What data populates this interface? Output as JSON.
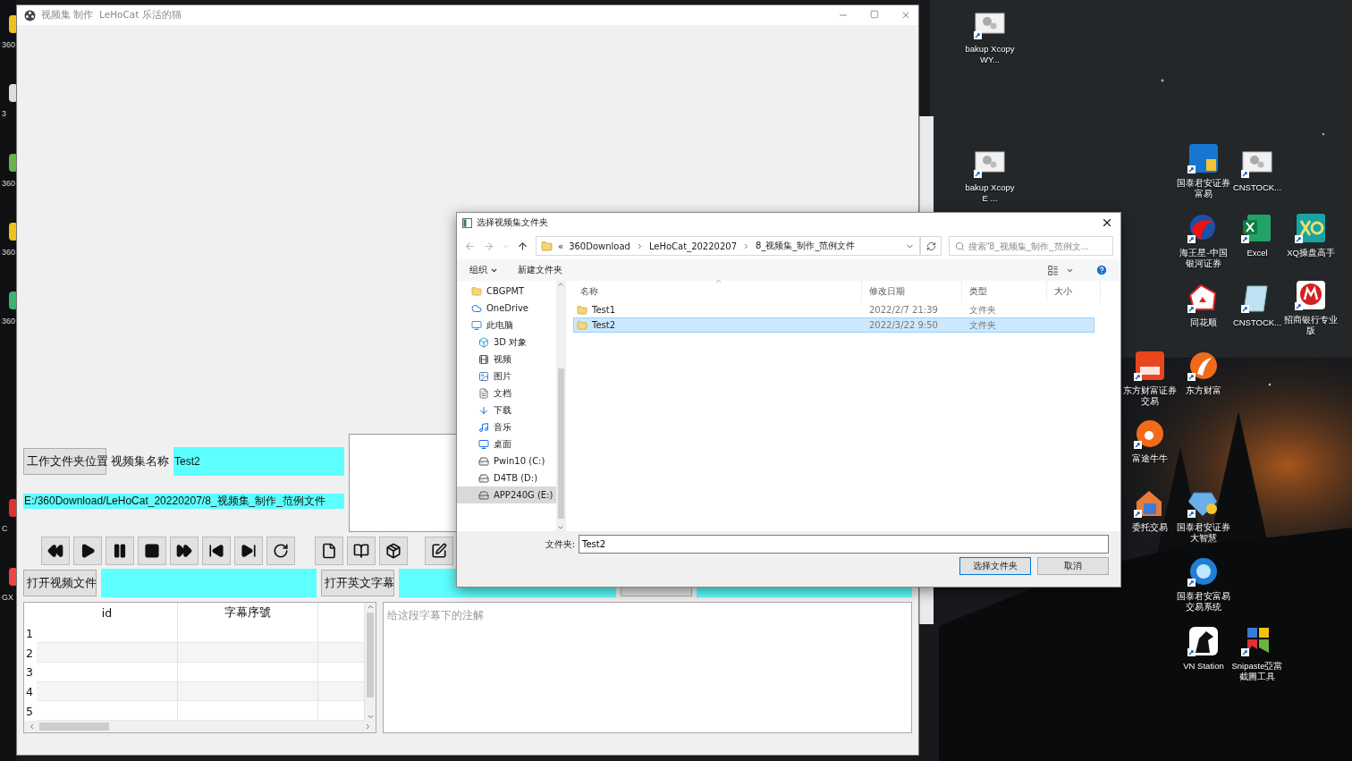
{
  "desktop_edge_labels": [
    "360",
    "3",
    "360",
    "360",
    "360",
    "C",
    "GX"
  ],
  "desktop_icons": [
    {
      "label": "bakup Xcopy WY..."
    },
    {
      "label": "bakup Xcopy E ..."
    },
    {
      "label": "国泰君安证券富易"
    },
    {
      "label": "CNSTOCK..."
    },
    {
      "label": "海王星-中国银河证券"
    },
    {
      "label": "Excel"
    },
    {
      "label": "XQ操盘高手"
    },
    {
      "label": "同花顺"
    },
    {
      "label": "CNSTOCK..."
    },
    {
      "label": "招商银行专业版"
    },
    {
      "label": "东方财富证券交易"
    },
    {
      "label": "东方财富"
    },
    {
      "label": "富途牛牛"
    },
    {
      "label": "委托交易"
    },
    {
      "label": "国泰君安证券大智慧"
    },
    {
      "label": "国泰君安富易交易系统"
    },
    {
      "label": "VN Station"
    },
    {
      "label": "Snipaste亞當截圖工具"
    }
  ],
  "main_window": {
    "title": "视频集 制作  LeHoCat 乐活的猫",
    "folder_button": "工作文件夹位置",
    "name_label": "视频集名称",
    "name_value": "Test2",
    "path_value": "E:/360Download/LeHoCat_20220207/8_视频集_制作_范例文件",
    "open_video_button": "打开视频文件",
    "open_subtitle_button": "打开英文字幕",
    "table": {
      "columns": [
        "id",
        "字幕序號"
      ],
      "row_headers": [
        "1",
        "2",
        "3",
        "4",
        "5"
      ]
    },
    "note": {
      "placeholder": "给这段字幕下的注解"
    }
  },
  "dialog": {
    "title": "选择视频集文件夹",
    "breadcrumb_prefix": "«",
    "breadcrumbs": [
      "360Download",
      "LeHoCat_20220207",
      "8_视频集_制作_范例文件"
    ],
    "search": {
      "placeholder": "搜索\"8_视频集_制作_范例文..."
    },
    "toolbar": [
      "组织",
      "新建文件夹"
    ],
    "tree": [
      {
        "label": "CBGPMT",
        "selected": false
      },
      {
        "label": "OneDrive",
        "selected": false
      },
      {
        "label": "此电脑",
        "selected": false,
        "children": [
          {
            "label": "3D 对象",
            "selected": false
          },
          {
            "label": "视频",
            "selected": false
          },
          {
            "label": "图片",
            "selected": false
          },
          {
            "label": "文档",
            "selected": false
          },
          {
            "label": "下载",
            "selected": false
          },
          {
            "label": "音乐",
            "selected": false
          },
          {
            "label": "桌面",
            "selected": false
          },
          {
            "label": "Pwin10 (C:)",
            "selected": false
          },
          {
            "label": "D4TB (D:)",
            "selected": false
          },
          {
            "label": "APP240G (E:)",
            "selected": true
          }
        ]
      }
    ],
    "columns": [
      "名称",
      "修改日期",
      "类型",
      "大小"
    ],
    "rows": [
      {
        "name": "Test1",
        "modified": "2022/2/7 21:39",
        "type": "文件夹",
        "selected": false
      },
      {
        "name": "Test2",
        "modified": "2022/3/22 9:50",
        "type": "文件夹",
        "selected": true
      }
    ],
    "folder_label": "文件夹:",
    "folder_value": "Test2",
    "buttons": [
      "选择文件夹",
      "取消"
    ]
  }
}
